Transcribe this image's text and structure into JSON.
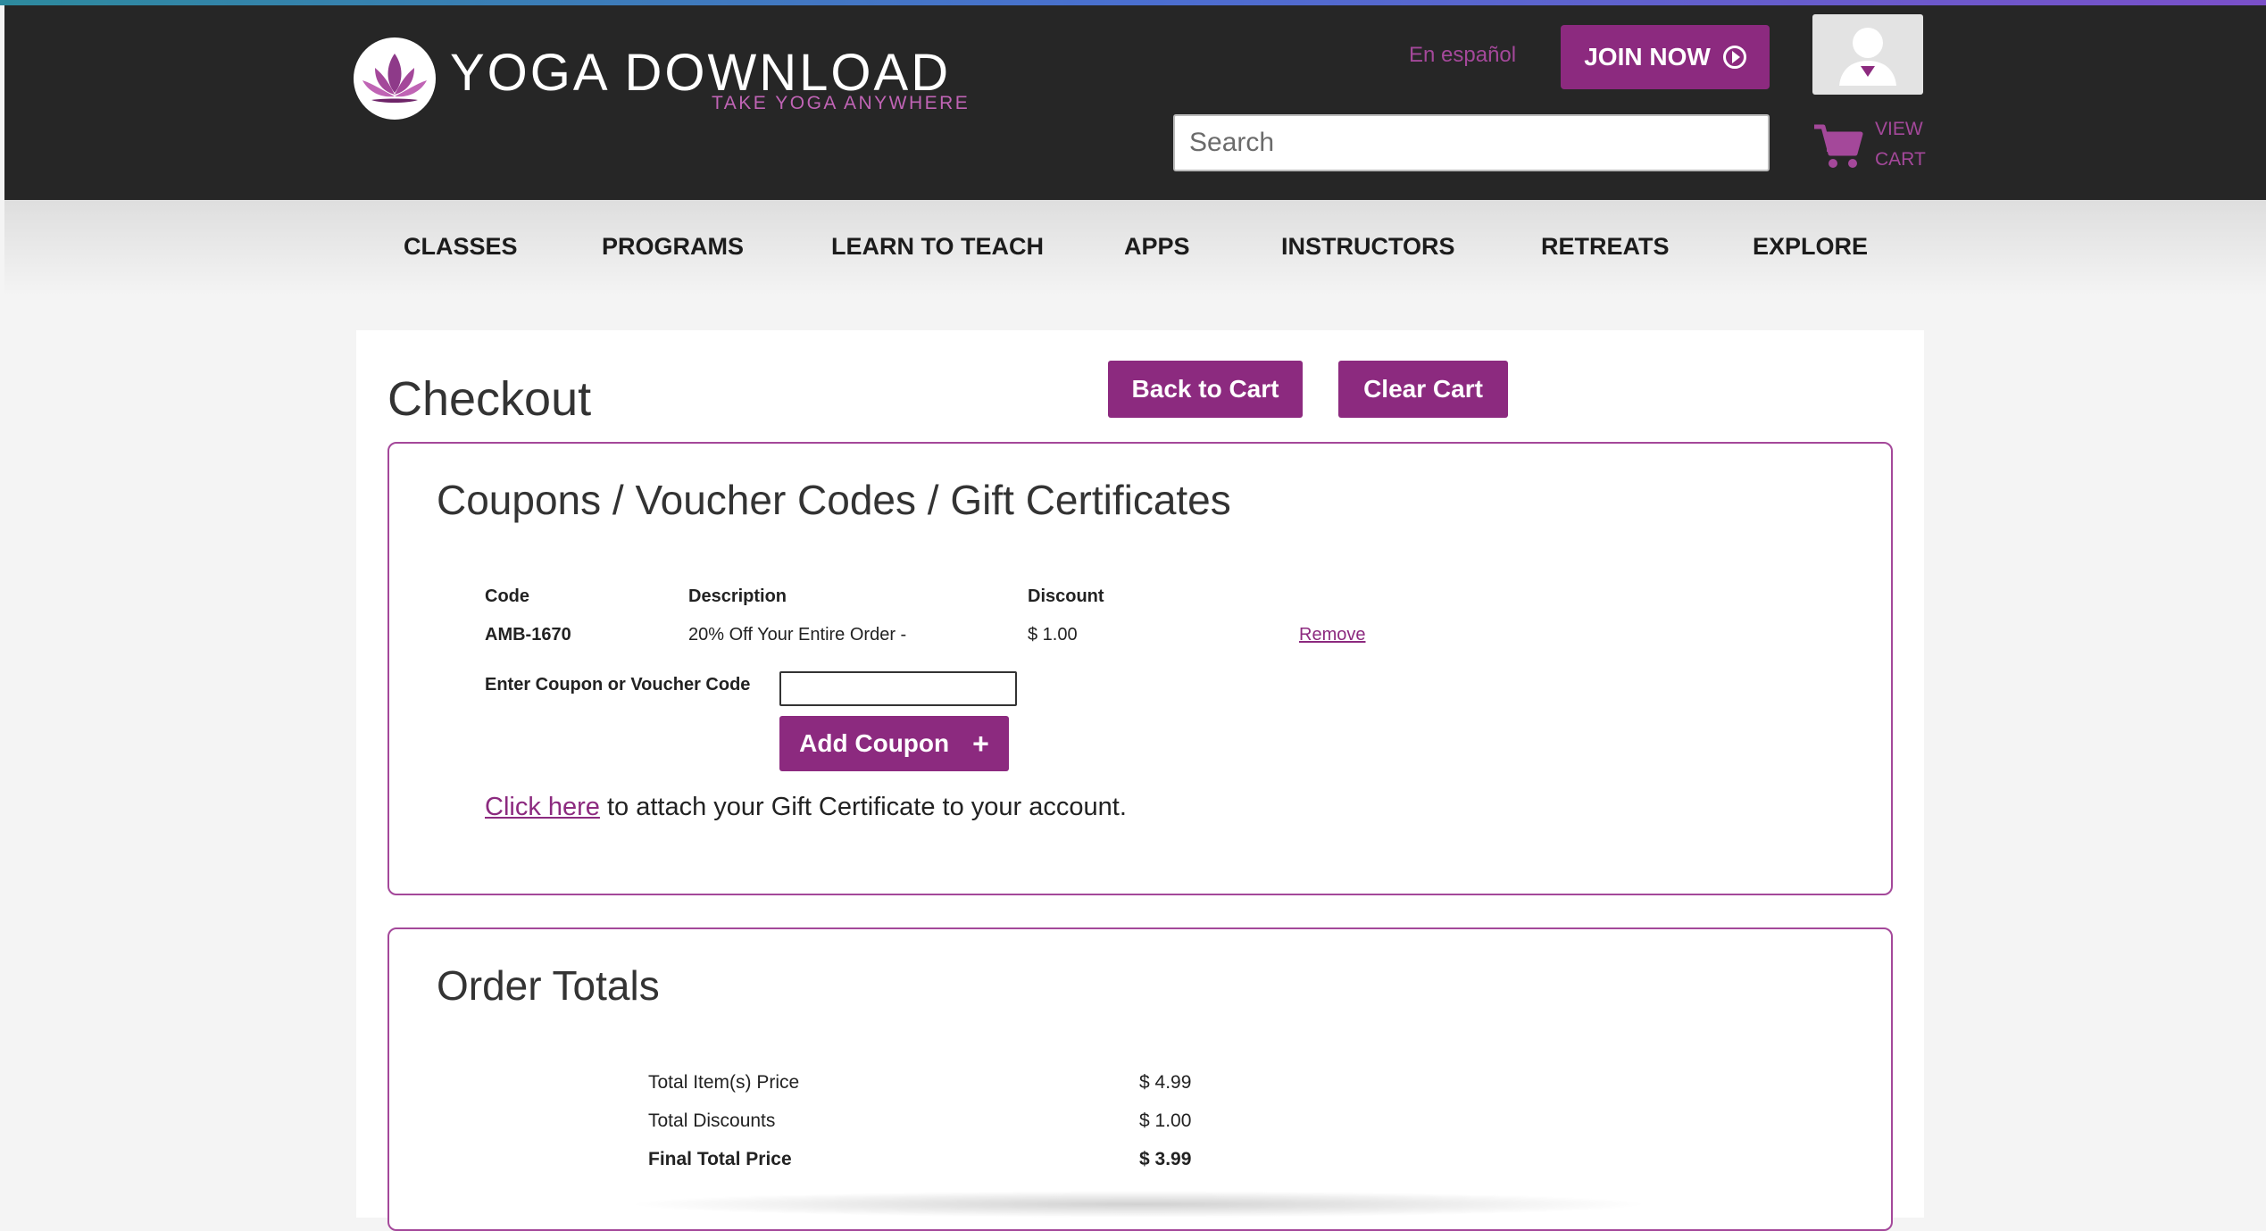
{
  "brand": {
    "name": "YOGA DOWNLOAD",
    "tagline": "TAKE YOGA ANYWHERE",
    "accent_color": "#8c2a7f",
    "header_bg": "#262626"
  },
  "header": {
    "language_link": "En español",
    "join_label": "JOIN NOW",
    "join_icon": "arrow-circle-icon",
    "search_placeholder": "Search",
    "cart_line1": "VIEW",
    "cart_line2": "CART",
    "cart_icon": "shopping-cart-icon",
    "user_icon": "user-avatar-icon"
  },
  "nav": {
    "items": [
      {
        "label": "CLASSES"
      },
      {
        "label": "PROGRAMS"
      },
      {
        "label": "LEARN TO TEACH"
      },
      {
        "label": "APPS"
      },
      {
        "label": "INSTRUCTORS"
      },
      {
        "label": "RETREATS"
      },
      {
        "label": "EXPLORE"
      }
    ]
  },
  "checkout": {
    "title": "Checkout",
    "back_to_cart": "Back to Cart",
    "clear_cart": "Clear Cart"
  },
  "coupons": {
    "title": "Coupons / Voucher Codes / Gift Certificates",
    "headers": {
      "code": "Code",
      "description": "Description",
      "discount": "Discount"
    },
    "rows": [
      {
        "code": "AMB-1670",
        "description": "20% Off Your Entire Order -",
        "discount": "$ 1.00",
        "action": "Remove"
      }
    ],
    "enter_label": "Enter Coupon or Voucher Code",
    "add_button": "Add Coupon",
    "add_icon": "plus-icon",
    "gift_link": "Click here",
    "gift_text": " to attach your Gift Certificate to your account."
  },
  "totals": {
    "title": "Order Totals",
    "rows": [
      {
        "label": "Total Item(s) Price",
        "value": "$ 4.99"
      },
      {
        "label": "Total Discounts",
        "value": "$ 1.00"
      },
      {
        "label": "Final Total Price",
        "value": "$ 3.99"
      }
    ]
  }
}
